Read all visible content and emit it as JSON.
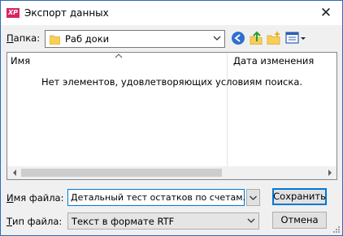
{
  "window": {
    "title": "Экспорт данных",
    "app_badge": "XP",
    "close_glyph": "✕"
  },
  "folder": {
    "label_accel": "П",
    "label_rest": "апка:",
    "value": "Раб доки"
  },
  "list": {
    "columns": [
      "Имя",
      "Дата изменения"
    ],
    "empty_message": "Нет элементов, удовлетворяющих условиям поиска."
  },
  "filename": {
    "label_accel": "И",
    "label_rest": "мя файла:",
    "value": "Детальный тест остатков по счетам.rtf"
  },
  "filetype": {
    "label_accel": "Т",
    "label_rest": "ип файла:",
    "value": "Текст в формате RTF"
  },
  "buttons": {
    "save": "Сохранить",
    "cancel": "Отмена"
  },
  "icons": {
    "back": "back-arrow-icon",
    "up": "up-folder-icon",
    "new_folder": "new-folder-icon",
    "view": "view-menu-icon"
  },
  "colors": {
    "accent": "#0078d7",
    "badge": "#d9255f",
    "folder": "#f6cf57"
  }
}
